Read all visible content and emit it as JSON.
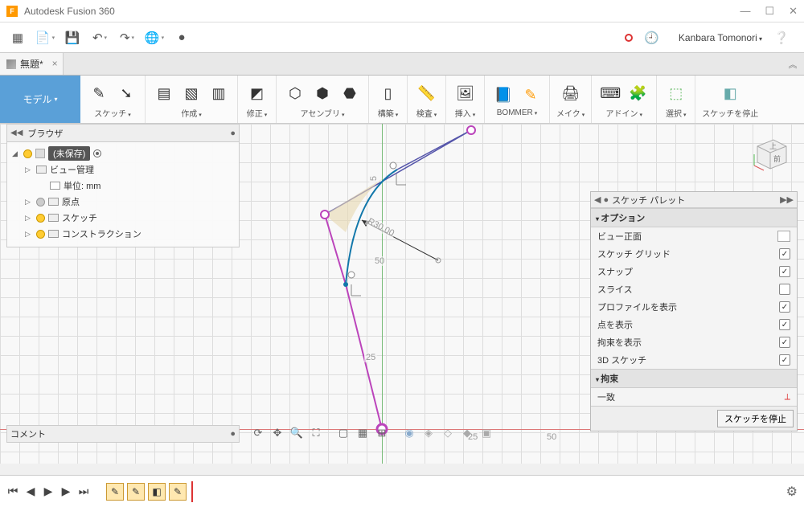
{
  "window": {
    "title": "Autodesk Fusion 360"
  },
  "tab": {
    "name": "無題*"
  },
  "user": {
    "name": "Kanbara Tomonori"
  },
  "ribbon": {
    "model": "モデル",
    "sketch": "スケッチ",
    "create": "作成",
    "modify": "修正",
    "assembly": "アセンブリ",
    "construct": "構築",
    "inspect": "検査",
    "insert": "挿入",
    "bommer": "BOMMER",
    "make": "メイク",
    "addin": "アドイン",
    "select": "選択",
    "stop": "スケッチを停止"
  },
  "browser": {
    "title": "ブラウザ",
    "root": "(未保存)",
    "items": {
      "view_mgmt": "ビュー管理",
      "units": "単位: mm",
      "origin": "原点",
      "sketch": "スケッチ",
      "construction": "コンストラクション"
    }
  },
  "palette": {
    "title": "スケッチ パレット",
    "section_options": "オプション",
    "section_constraint": "拘束",
    "rows": {
      "look_at": "ビュー正面",
      "grid": "スケッチ グリッド",
      "snap": "スナップ",
      "slice": "スライス",
      "profile": "プロファイルを表示",
      "points": "点を表示",
      "constraints": "拘束を表示",
      "sketch3d": "3D スケッチ",
      "coincident": "一致"
    },
    "footer_btn": "スケッチを停止"
  },
  "comment": {
    "label": "コメント"
  },
  "dims": {
    "r30": "R30.00",
    "d50": "50",
    "d25": "25",
    "tick25": "25",
    "tick50": "50",
    "vtick5": "5"
  },
  "viewcube": {
    "top": "上",
    "front": "前"
  }
}
